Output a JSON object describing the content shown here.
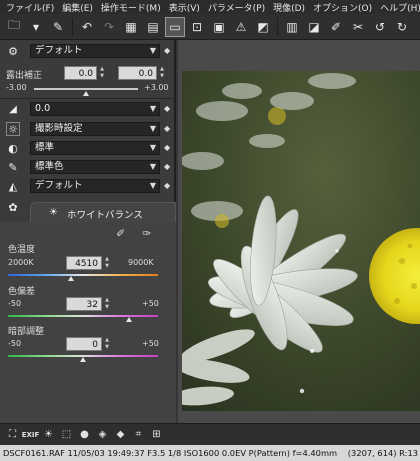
{
  "menu": [
    "ファイル(F)",
    "編集(E)",
    "操作モード(M)",
    "表示(V)",
    "パラメータ(P)",
    "現像(D)",
    "オプション(O)",
    "ヘルプ(H)"
  ],
  "toolbar": {
    "icons": [
      "folder-icon",
      "folder-open-icon",
      "sticky-note-icon",
      "undo-icon",
      "redo-icon",
      "grid-view-icon",
      "list-view-icon",
      "single-view-icon",
      "fit-view-icon",
      "gallery-icon",
      "warning-icon",
      "exposure-icon",
      "histogram-icon",
      "compare-icon",
      "eyedropper-icon",
      "pin-icon",
      "rotate-left-icon",
      "rotate-right-icon"
    ]
  },
  "panel": {
    "preset_label": "デフォルト",
    "exposure": {
      "label": "露出補正",
      "value1": "0.0",
      "value2": "0.0",
      "min": "-3.00",
      "max": "+3.00",
      "level": 0.5
    },
    "contrast_value": "0.0",
    "picture_mode": "撮影時設定",
    "tone": "標準",
    "color": "標準色",
    "sharpness": "デフォルト",
    "wb_tab": "ホワイトバランス",
    "color_temp": {
      "label": "色温度",
      "min": "2000K",
      "value": "4510",
      "max": "9000K",
      "level": 0.36
    },
    "tint": {
      "label": "色偏差",
      "min": "-50",
      "value": "32",
      "max": "+50",
      "level": 0.82
    },
    "shadow": {
      "label": "暗部調整",
      "min": "-50",
      "value": "0",
      "max": "+50",
      "level": 0.5
    }
  },
  "colors": {
    "accent": "#2f6fb0"
  },
  "status": {
    "info": "DSCF0161.RAF 11/05/03 19:49:37 F3.5 1/8 ISO1600 0.0EV P(Pattern) f=4.40mm",
    "coords": "(3207, 614) R:13"
  }
}
